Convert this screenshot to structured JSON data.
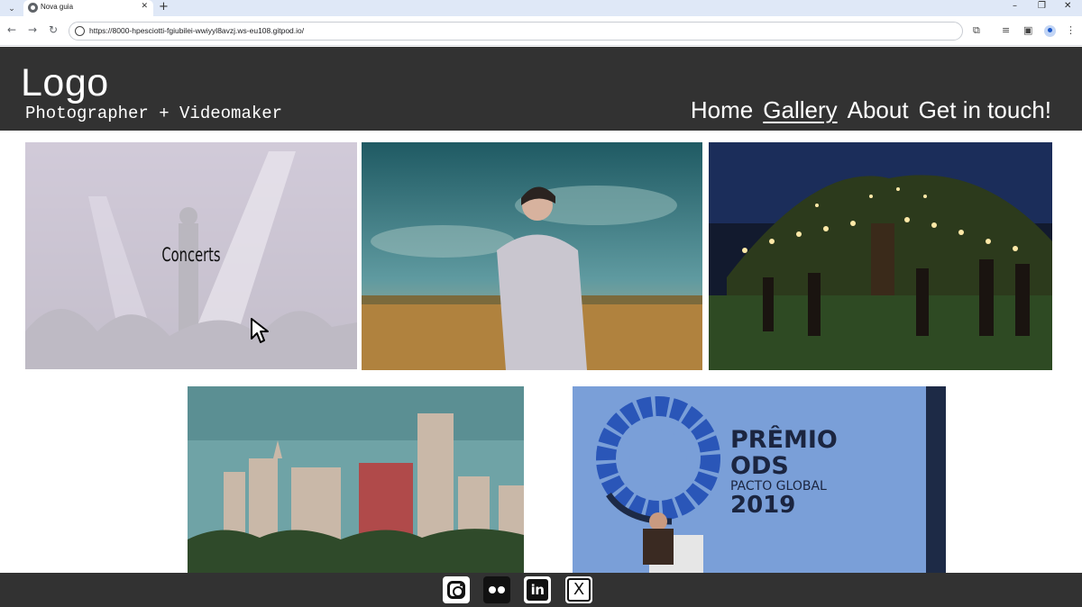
{
  "browser": {
    "tab_title": "Nova guia",
    "tab_close": "✕",
    "new_tab": "+",
    "url": "https://8000-hpesciotti-fgiubilei-wwiyyl8avzj.ws-eu108.gitpod.io/",
    "window_controls": [
      "–",
      "❐",
      "✕"
    ],
    "nav_icons": [
      "back-icon",
      "forward-icon",
      "reload-icon"
    ],
    "toolbar_icons": [
      "extensions-icon",
      "reading-list-icon",
      "side-panel-icon",
      "profile-icon",
      "menu-icon"
    ]
  },
  "header": {
    "logo": "Logo",
    "tagline": "Photographer + Videomaker",
    "nav": [
      {
        "label": "Home",
        "active": false
      },
      {
        "label": "Gallery",
        "active": true
      },
      {
        "label": "About",
        "active": false
      },
      {
        "label": "Get in touch!",
        "active": false
      }
    ]
  },
  "gallery": {
    "items": [
      {
        "name": "concert",
        "hover_label": "Concerts"
      },
      {
        "name": "portrait-field"
      },
      {
        "name": "night-party"
      },
      {
        "name": "city-skyline"
      },
      {
        "name": "award-event",
        "sign_lines": [
          "PRÊMIO",
          "ODS",
          "PACTO GLOBAL",
          "2019"
        ]
      }
    ]
  },
  "footer": {
    "social": [
      "instagram-icon",
      "flickr-icon",
      "linkedin-icon",
      "x-twitter-icon"
    ],
    "linkedin_text": "in",
    "x_text": "X"
  }
}
